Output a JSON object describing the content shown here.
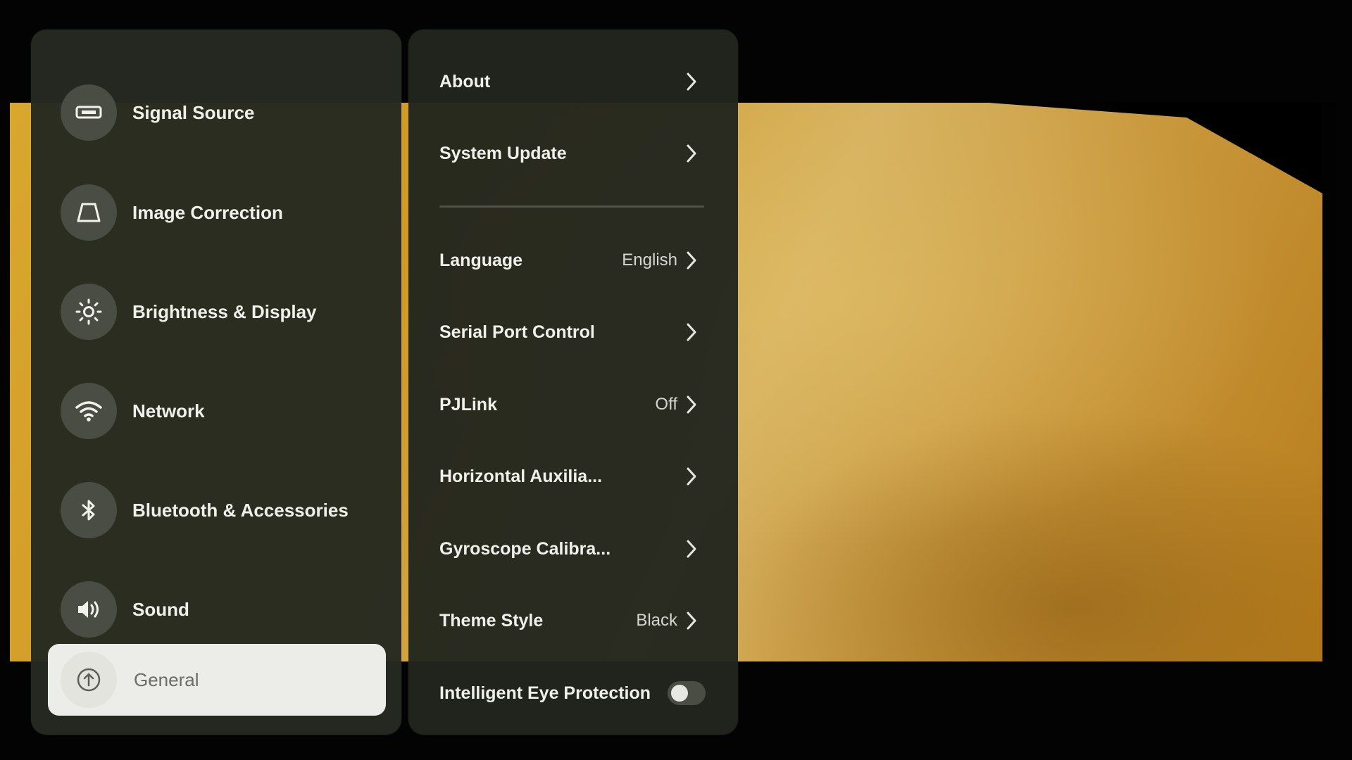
{
  "sidebar": {
    "items": [
      {
        "label": "Signal Source",
        "icon": "hdmi-icon"
      },
      {
        "label": "Image Correction",
        "icon": "keystone-icon"
      },
      {
        "label": "Brightness & Display",
        "icon": "brightness-icon"
      },
      {
        "label": "Network",
        "icon": "wifi-icon"
      },
      {
        "label": "Bluetooth & Accessories",
        "icon": "bluetooth-icon"
      },
      {
        "label": "Sound",
        "icon": "speaker-icon"
      },
      {
        "label": "General",
        "icon": "arrow-up-circle-icon",
        "selected": true
      }
    ]
  },
  "settings": {
    "rows": [
      {
        "label": "About",
        "value": ""
      },
      {
        "label": "System Update",
        "value": ""
      },
      {
        "label": "Language",
        "value": "English"
      },
      {
        "label": "Serial Port Control",
        "value": ""
      },
      {
        "label": "PJLink",
        "value": "Off"
      },
      {
        "label": "Horizontal Auxilia...",
        "value": ""
      },
      {
        "label": "Gyroscope Calibra...",
        "value": ""
      },
      {
        "label": "Theme Style",
        "value": "Black"
      },
      {
        "label": "Intelligent Eye Protection",
        "toggle": false
      }
    ]
  },
  "colors": {
    "panel": "#26291f",
    "selected_item": "#ecede8",
    "text": "#f0f0ea"
  }
}
